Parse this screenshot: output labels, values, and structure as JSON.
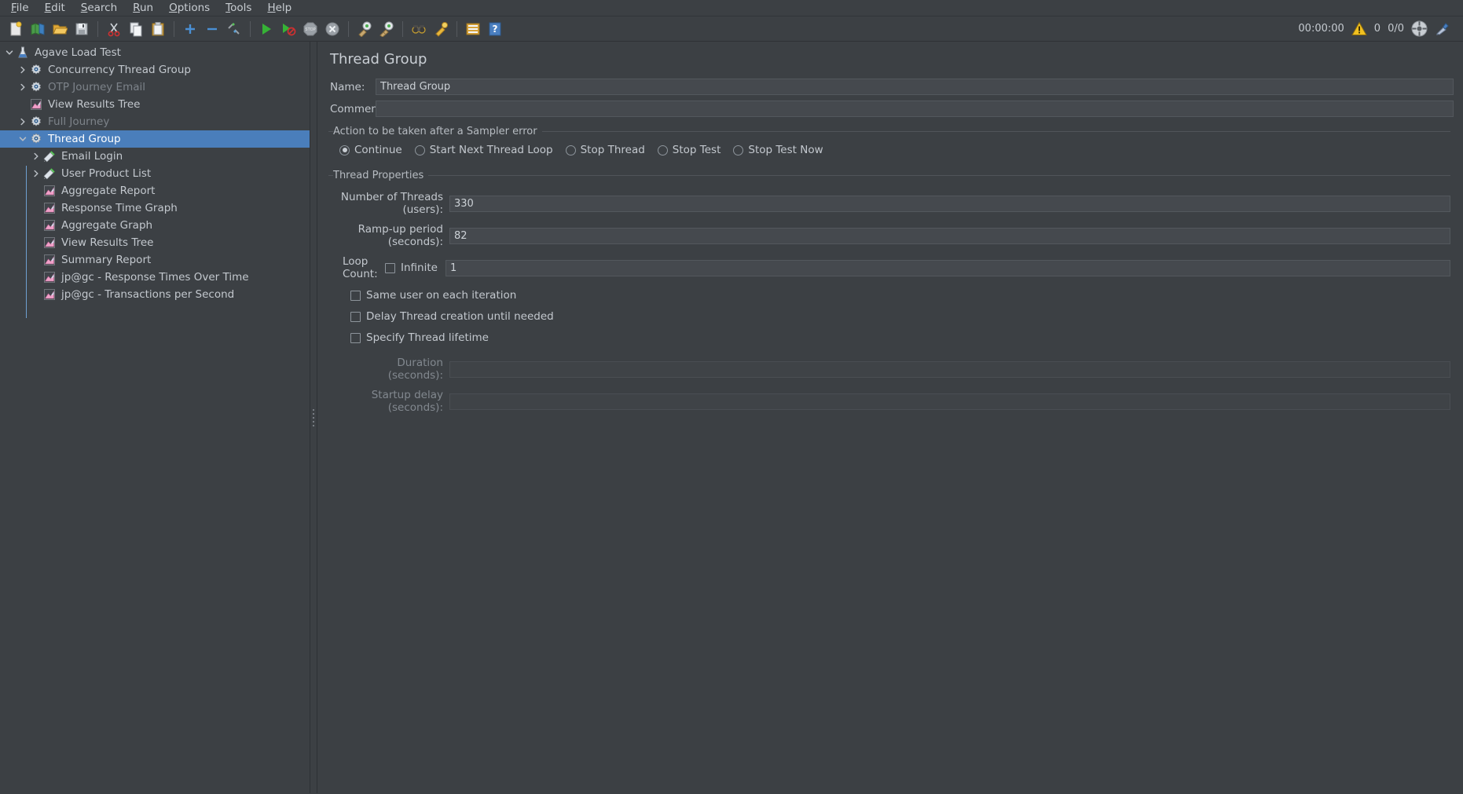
{
  "menubar": {
    "items": [
      {
        "label": "File",
        "mnemonic": "F"
      },
      {
        "label": "Edit",
        "mnemonic": "E"
      },
      {
        "label": "Search",
        "mnemonic": "S"
      },
      {
        "label": "Run",
        "mnemonic": "R"
      },
      {
        "label": "Options",
        "mnemonic": "O"
      },
      {
        "label": "Tools",
        "mnemonic": "T"
      },
      {
        "label": "Help",
        "mnemonic": "H"
      }
    ]
  },
  "toolbar": {
    "buttons": [
      {
        "name": "new-icon",
        "title": "New"
      },
      {
        "name": "templates-icon",
        "title": "Templates"
      },
      {
        "name": "open-icon",
        "title": "Open"
      },
      {
        "name": "save-icon",
        "title": "Save Test Plan"
      },
      {
        "name": "cut-icon",
        "title": "Cut"
      },
      {
        "name": "copy-icon",
        "title": "Copy"
      },
      {
        "name": "paste-icon",
        "title": "Paste"
      },
      {
        "name": "expand-all-icon",
        "title": "Expand All"
      },
      {
        "name": "collapse-all-icon",
        "title": "Collapse All"
      },
      {
        "name": "toggle-icon",
        "title": "Toggle"
      },
      {
        "name": "start-icon",
        "title": "Start"
      },
      {
        "name": "start-no-pauses-icon",
        "title": "Start no pauses"
      },
      {
        "name": "stop-icon",
        "title": "Stop"
      },
      {
        "name": "shutdown-icon",
        "title": "Shutdown"
      },
      {
        "name": "clear-icon",
        "title": "Clear"
      },
      {
        "name": "clear-all-icon",
        "title": "Clear All"
      },
      {
        "name": "search-icon",
        "title": "Search"
      },
      {
        "name": "search-reset-icon",
        "title": "Reset Search"
      },
      {
        "name": "function-helper-icon",
        "title": "Function Helper Dialog"
      },
      {
        "name": "help-icon",
        "title": "Help"
      }
    ]
  },
  "status": {
    "elapsed_time": "00:00:00",
    "warning_count": "0",
    "thread_counts": "0/0",
    "warning_icon": "warning-triangle-icon",
    "remote_icon": "remote-engines-icon",
    "clear_icon": "clear-gui-icon"
  },
  "tree": {
    "nodes": [
      {
        "label": "Agave Load Test",
        "icon": "test-plan-icon",
        "depth": 0,
        "twisty": "down",
        "selected": false,
        "disabled": false
      },
      {
        "label": "Concurrency Thread Group",
        "icon": "thread-group-icon",
        "depth": 1,
        "twisty": "right",
        "selected": false,
        "disabled": false
      },
      {
        "label": "OTP Journey Email",
        "icon": "thread-group-icon",
        "depth": 1,
        "twisty": "right",
        "selected": false,
        "disabled": true
      },
      {
        "label": "View Results Tree",
        "icon": "listener-icon",
        "depth": 1,
        "twisty": "none",
        "selected": false,
        "disabled": false
      },
      {
        "label": "Full Journey",
        "icon": "thread-group-icon",
        "depth": 1,
        "twisty": "right",
        "selected": false,
        "disabled": true
      },
      {
        "label": "Thread Group",
        "icon": "thread-group-icon",
        "depth": 1,
        "twisty": "down",
        "selected": true,
        "disabled": false
      },
      {
        "label": "Email Login",
        "icon": "sampler-icon",
        "depth": 2,
        "twisty": "right",
        "selected": false,
        "disabled": false
      },
      {
        "label": "User Product List",
        "icon": "sampler-icon",
        "depth": 2,
        "twisty": "right",
        "selected": false,
        "disabled": false
      },
      {
        "label": "Aggregate Report",
        "icon": "listener-icon",
        "depth": 2,
        "twisty": "none",
        "selected": false,
        "disabled": false
      },
      {
        "label": "Response Time Graph",
        "icon": "listener-icon",
        "depth": 2,
        "twisty": "none",
        "selected": false,
        "disabled": false
      },
      {
        "label": "Aggregate Graph",
        "icon": "listener-icon",
        "depth": 2,
        "twisty": "none",
        "selected": false,
        "disabled": false
      },
      {
        "label": "View Results Tree",
        "icon": "listener-icon",
        "depth": 2,
        "twisty": "none",
        "selected": false,
        "disabled": false
      },
      {
        "label": "Summary Report",
        "icon": "listener-icon",
        "depth": 2,
        "twisty": "none",
        "selected": false,
        "disabled": false
      },
      {
        "label": "jp@gc - Response Times Over Time",
        "icon": "listener-icon",
        "depth": 2,
        "twisty": "none",
        "selected": false,
        "disabled": false
      },
      {
        "label": "jp@gc - Transactions per Second",
        "icon": "listener-icon",
        "depth": 2,
        "twisty": "none",
        "selected": false,
        "disabled": false
      }
    ]
  },
  "editor": {
    "title": "Thread Group",
    "name_label": "Name:",
    "name_value": "Thread Group",
    "comments_label": "Comments:",
    "comments_value": "",
    "error_action": {
      "group_title": "Action to be taken after a Sampler error",
      "options": [
        {
          "label": "Continue",
          "checked": true
        },
        {
          "label": "Start Next Thread Loop",
          "checked": false
        },
        {
          "label": "Stop Thread",
          "checked": false
        },
        {
          "label": "Stop Test",
          "checked": false
        },
        {
          "label": "Stop Test Now",
          "checked": false
        }
      ]
    },
    "thread_properties": {
      "group_title": "Thread Properties",
      "num_threads_label": "Number of Threads (users):",
      "num_threads_value": "330",
      "rampup_label": "Ramp-up period (seconds):",
      "rampup_value": "82",
      "loop_count_label": "Loop Count:",
      "infinite_label": "Infinite",
      "infinite_checked": false,
      "loop_count_value": "1",
      "checkboxes": [
        {
          "label": "Same user on each iteration",
          "checked": false
        },
        {
          "label": "Delay Thread creation until needed",
          "checked": false
        },
        {
          "label": "Specify Thread lifetime",
          "checked": false
        }
      ],
      "duration_label": "Duration (seconds):",
      "duration_value": "",
      "duration_disabled": true,
      "startup_delay_label": "Startup delay (seconds):",
      "startup_delay_value": "",
      "startup_delay_disabled": true
    }
  },
  "colors": {
    "background": "#3c4044",
    "selection": "#4a7ebb",
    "text": "#c3c8ce",
    "text_disabled": "#7d838a",
    "field_bg": "#45494e",
    "border": "#53585d",
    "guide_line": "#6f9fd0"
  }
}
